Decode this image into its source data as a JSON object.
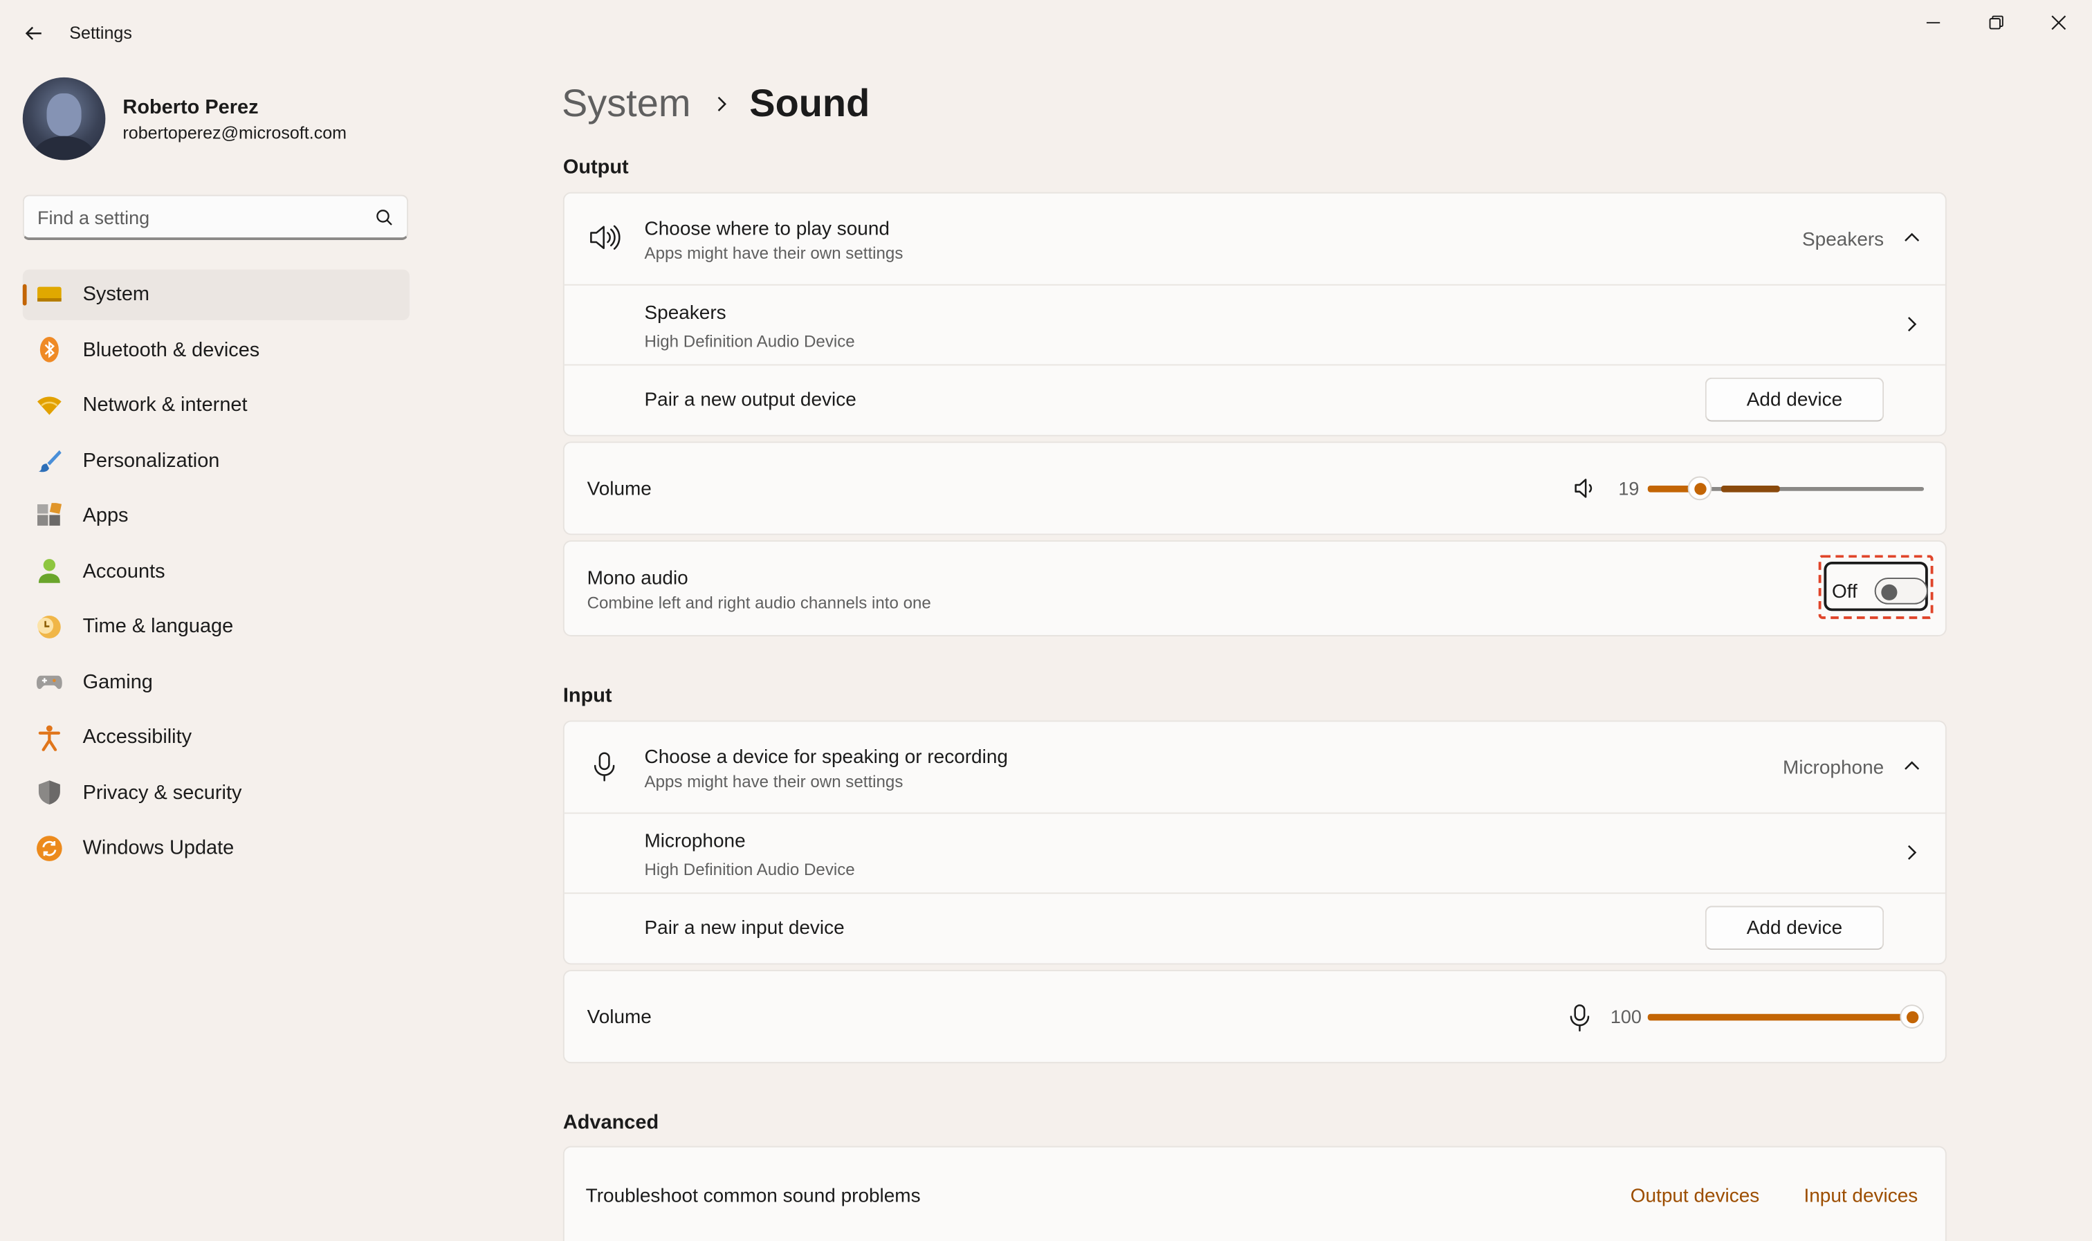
{
  "window": {
    "title": "Settings"
  },
  "profile": {
    "name": "Roberto Perez",
    "email": "robertoperez@microsoft.com"
  },
  "search": {
    "placeholder": "Find a setting"
  },
  "nav": {
    "items": [
      {
        "label": "System",
        "icon": "system-icon",
        "active": true
      },
      {
        "label": "Bluetooth & devices",
        "icon": "bluetooth-icon"
      },
      {
        "label": "Network & internet",
        "icon": "wifi-icon"
      },
      {
        "label": "Personalization",
        "icon": "brush-icon"
      },
      {
        "label": "Apps",
        "icon": "apps-icon"
      },
      {
        "label": "Accounts",
        "icon": "accounts-icon"
      },
      {
        "label": "Time & language",
        "icon": "clock-icon"
      },
      {
        "label": "Gaming",
        "icon": "gamepad-icon"
      },
      {
        "label": "Accessibility",
        "icon": "accessibility-icon"
      },
      {
        "label": "Privacy & security",
        "icon": "shield-icon"
      },
      {
        "label": "Windows Update",
        "icon": "update-icon"
      }
    ]
  },
  "breadcrumb": {
    "parent": "System",
    "current": "Sound"
  },
  "output": {
    "section_title": "Output",
    "choose": {
      "title": "Choose where to play sound",
      "subtitle": "Apps might have their own settings",
      "value": "Speakers"
    },
    "device": {
      "name": "Speakers",
      "description": "High Definition Audio Device"
    },
    "pair": {
      "label": "Pair a new output device",
      "button": "Add device"
    },
    "volume": {
      "label": "Volume",
      "value": "19",
      "level": 0.19
    },
    "mono": {
      "title": "Mono audio",
      "subtitle": "Combine left and right audio channels into one",
      "state": "Off"
    }
  },
  "input": {
    "section_title": "Input",
    "choose": {
      "title": "Choose a device for speaking or recording",
      "subtitle": "Apps might have their own settings",
      "value": "Microphone"
    },
    "device": {
      "name": "Microphone",
      "description": "High Definition Audio Device"
    },
    "pair": {
      "label": "Pair a new input device",
      "button": "Add device"
    },
    "volume": {
      "label": "Volume",
      "value": "100",
      "level": 1.0
    }
  },
  "advanced": {
    "section_title": "Advanced",
    "troubleshoot": {
      "label": "Troubleshoot common sound problems",
      "link_output": "Output devices",
      "link_input": "Input devices"
    }
  },
  "colors": {
    "accent": "#c36505",
    "link": "#9c4d00",
    "background": "#f5f0ec",
    "card": "#fbfaf9",
    "focus_dashed": "#e0452a"
  }
}
